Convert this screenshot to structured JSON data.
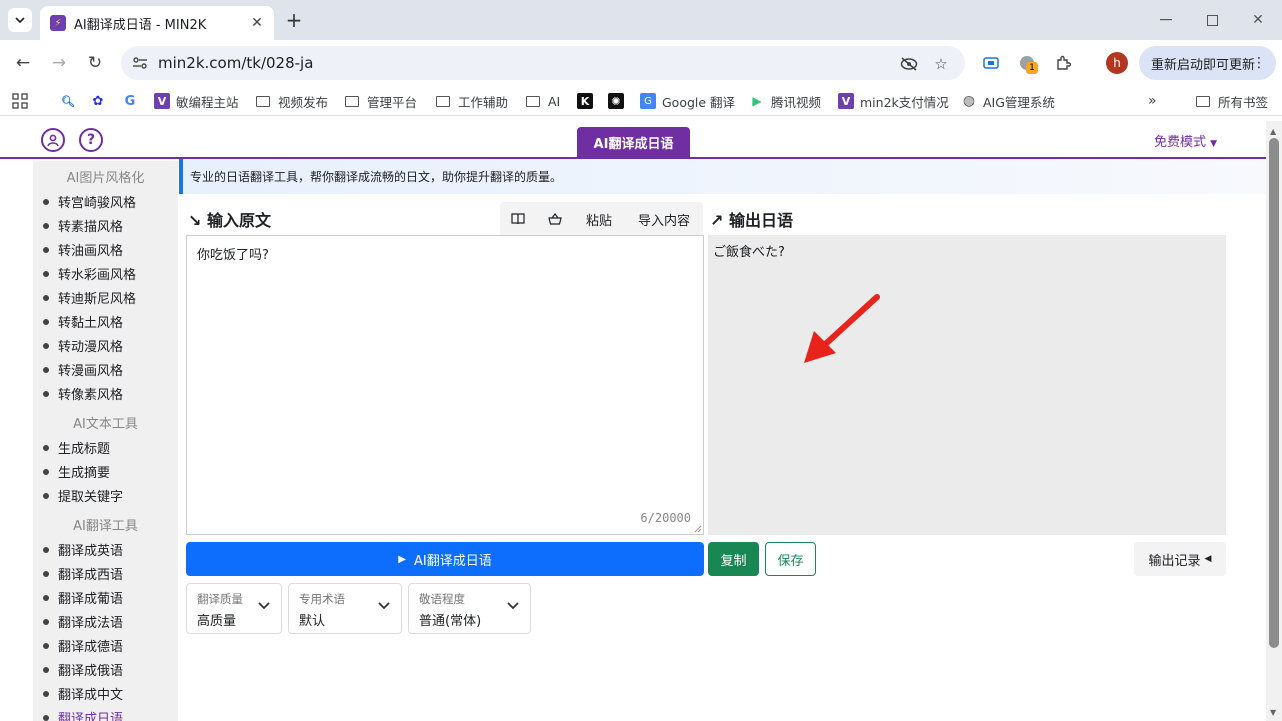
{
  "browser": {
    "tab_title": "AI翻译成日语 - MIN2K",
    "url": "min2k.com/tk/028-ja",
    "update_label": "重新启动即可更新",
    "profile_initial": "h",
    "extension_badge": "1",
    "bookmarks": [
      {
        "label": "敏编程主站"
      },
      {
        "label": "视频发布"
      },
      {
        "label": "管理平台"
      },
      {
        "label": "工作辅助"
      },
      {
        "label": "AI"
      },
      {
        "label": "Google 翻译"
      },
      {
        "label": "腾讯视频"
      },
      {
        "label": "min2k支付情况"
      },
      {
        "label": "AIG管理系统"
      }
    ],
    "all_bookmarks": "所有书签"
  },
  "header": {
    "title": "AI翻译成日语",
    "mode": "免费模式"
  },
  "sidebar": {
    "categories": [
      {
        "label": "AI图片风格化",
        "items": [
          "转宫崎骏风格",
          "转素描风格",
          "转油画风格",
          "转水彩画风格",
          "转迪斯尼风格",
          "转黏土风格",
          "转动漫风格",
          "转漫画风格",
          "转像素风格"
        ]
      },
      {
        "label": "AI文本工具",
        "items": [
          "生成标题",
          "生成摘要",
          "提取关键字"
        ]
      },
      {
        "label": "AI翻译工具",
        "items": [
          "翻译成英语",
          "翻译成西语",
          "翻译成葡语",
          "翻译成法语",
          "翻译成德语",
          "翻译成俄语",
          "翻译成中文",
          "翻译成日语"
        ]
      }
    ]
  },
  "notice": "专业的日语翻译工具，帮你翻译成流畅的日文，助你提升翻译的质量。",
  "input": {
    "title": "输入原文",
    "paste_label": "粘贴",
    "import_label": "导入内容",
    "text": "你吃饭了吗?",
    "char_count": "6/20000"
  },
  "output": {
    "title": "输出日语",
    "text": "ご飯食べた?"
  },
  "actions": {
    "translate": "AI翻译成日语",
    "copy": "复制",
    "save": "保存",
    "history": "输出记录"
  },
  "options": [
    {
      "label": "翻译质量",
      "value": "高质量"
    },
    {
      "label": "专用术语",
      "value": "默认"
    },
    {
      "label": "敬语程度",
      "value": "普通(常体)"
    }
  ],
  "colors": {
    "brand": "#6f2fa3",
    "primary": "#0d6efd",
    "success": "#198754",
    "annotation": "#e8231b"
  }
}
